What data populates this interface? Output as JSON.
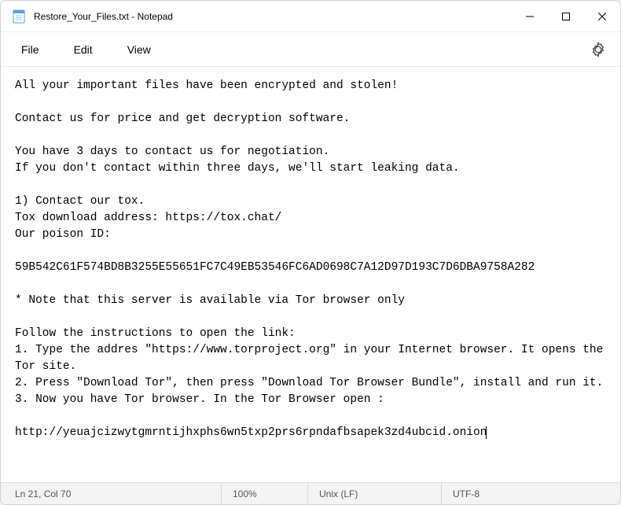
{
  "window": {
    "title": "Restore_Your_Files.txt - Notepad"
  },
  "menu": {
    "file": "File",
    "edit": "Edit",
    "view": "View"
  },
  "content": {
    "text": "All your important files have been encrypted and stolen!\n\nContact us for price and get decryption software.\n\nYou have 3 days to contact us for negotiation.\nIf you don't contact within three days, we'll start leaking data.\n\n1) Contact our tox.\nTox download address: https://tox.chat/\nOur poison ID:\n\n59B542C61F574BD8B3255E55651FC7C49EB53546FC6AD0698C7A12D97D193C7D6DBA9758A282\n\n* Note that this server is available via Tor browser only\n\nFollow the instructions to open the link:\n1. Type the addres \"https://www.torproject.org\" in your Internet browser. It opens the Tor site.\n2. Press \"Download Tor\", then press \"Download Tor Browser Bundle\", install and run it.\n3. Now you have Tor browser. In the Tor Browser open :\n\nhttp://yeuajcizwytgmrntijhxphs6wn5txp2prs6rpndafbsapek3zd4ubcid.onion"
  },
  "status": {
    "position": "Ln 21, Col 70",
    "zoom": "100%",
    "eol": "Unix (LF)",
    "encoding": "UTF-8"
  }
}
